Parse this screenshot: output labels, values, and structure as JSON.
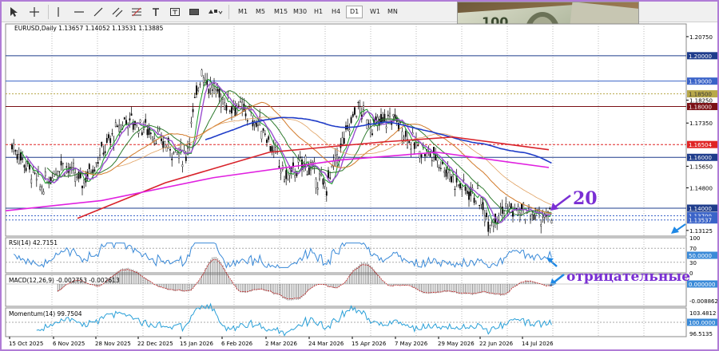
{
  "toolbar": {
    "timeframes": [
      "M1",
      "M5",
      "M15",
      "M30",
      "H1",
      "H4",
      "D1",
      "W1",
      "MN"
    ],
    "active_timeframe": "D1"
  },
  "chart_header": "EURUSD,Daily  1.13657 1.14052 1.13531 1.13885",
  "price_axis": {
    "ticks": [
      "1.20750",
      "1.18250",
      "1.17350",
      "1.15650",
      "1.14800",
      "1.13125"
    ],
    "levels": [
      {
        "label": "1.20000",
        "color": "#1e3c8c"
      },
      {
        "label": "1.19000",
        "color": "#3a63c8"
      },
      {
        "label": "1.18500",
        "color": "#b8a84a"
      },
      {
        "label": "1.18000",
        "color": "#7a0f14"
      },
      {
        "label": "1.16504",
        "color": "#e02424"
      },
      {
        "label": "1.16000",
        "color": "#1e3c8c"
      },
      {
        "label": "1.14000",
        "color": "#1e3c8c"
      },
      {
        "label": "1.13700",
        "color": "#3a63c8"
      },
      {
        "label": "1.13537",
        "color": "#3a63c8"
      }
    ]
  },
  "annotations": {
    "number": "20",
    "word": "отрицательные"
  },
  "rsi": {
    "header": "RSI(14) 42.7151",
    "ticks": [
      "100",
      "70",
      "30",
      "0"
    ],
    "badge": "50.0000"
  },
  "macd": {
    "header": "MACD(12,26,9) -0.002753 -0.002613",
    "badge": "0.000000",
    "tick": "-0.008862"
  },
  "momentum": {
    "header": "Momentum(14) 99.7504",
    "ticks": [
      "103.4812",
      "96.5135"
    ],
    "badge": "100.0000"
  },
  "time_axis": [
    "15 Oct 2025",
    "6 Nov 2025",
    "28 Nov 2025",
    "22 Dec 2025",
    "15 Jan 2026",
    "6 Feb 2026",
    "2 Mar 2026",
    "24 Mar 2026",
    "15 Apr 2026",
    "7 May 2026",
    "29 May 2026",
    "22 Jun 2026",
    "14 Jul 2026"
  ],
  "colors": {
    "accent_purple": "#7a2fd4",
    "arrow_blue": "#1e88e5",
    "ma_blue": "#1f3cc8",
    "ma_red": "#d8222a",
    "ma_magenta": "#e020e0",
    "ma_orange": "#d27a2a",
    "ma_green": "#1a9a2a",
    "ma_purple": "#9b4fd0",
    "rsi_line": "#3a8ad8",
    "momentum_line": "#2aa0d8"
  },
  "icons": [
    "cursor-icon",
    "crosshair-icon",
    "hline-icon",
    "trendline-icon",
    "channel-icon",
    "text-icon",
    "label-icon",
    "rectangle-icon",
    "shapes-icon"
  ]
}
